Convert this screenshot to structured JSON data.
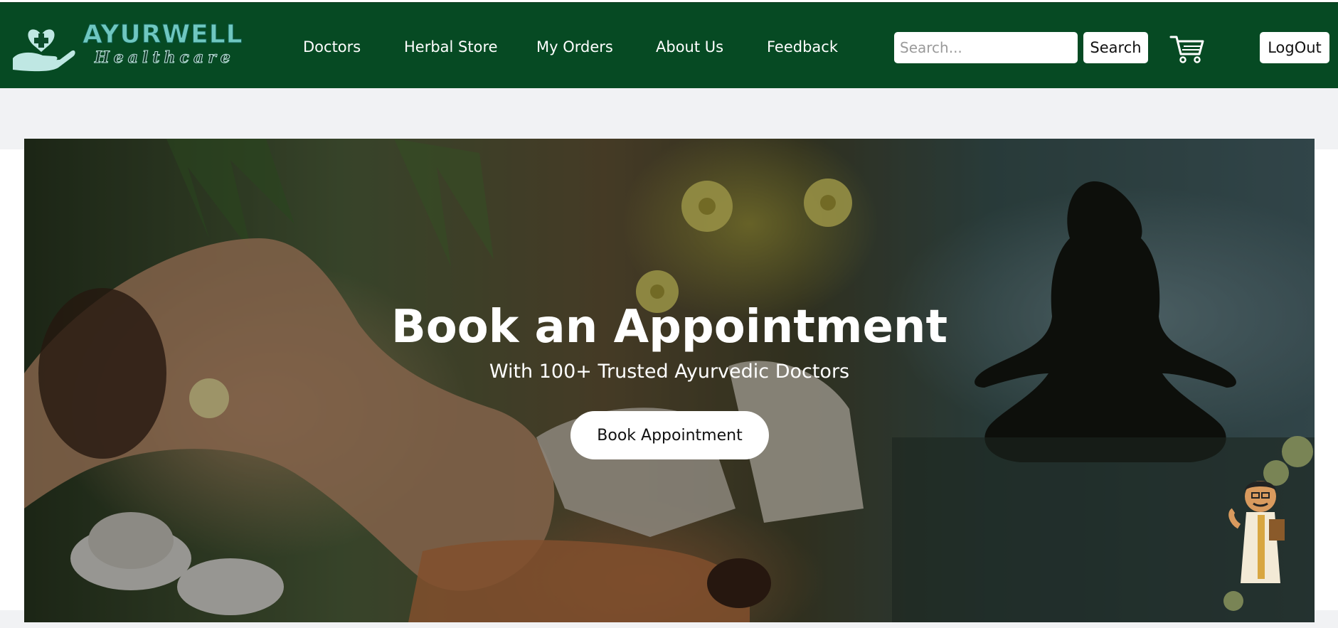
{
  "brand": {
    "name": "AYURWELL",
    "subtitle": "Healthcare"
  },
  "nav": {
    "items": [
      {
        "label": "Doctors"
      },
      {
        "label": "Herbal Store"
      },
      {
        "label": "My Orders"
      },
      {
        "label": "About Us"
      },
      {
        "label": "Feedback"
      }
    ]
  },
  "search": {
    "placeholder": "Search...",
    "value": "",
    "button_label": "Search"
  },
  "header": {
    "cart_icon": "cart-icon",
    "logout_label": "LogOut"
  },
  "hero": {
    "title": "Book an Appointment",
    "subtitle": "With 100+ Trusted Ayurvedic Doctors",
    "cta_label": "Book Appointment"
  },
  "colors": {
    "header_bg": "#064a23",
    "logo_teal": "#6fc7c0",
    "page_gray": "#f1f2f4"
  }
}
